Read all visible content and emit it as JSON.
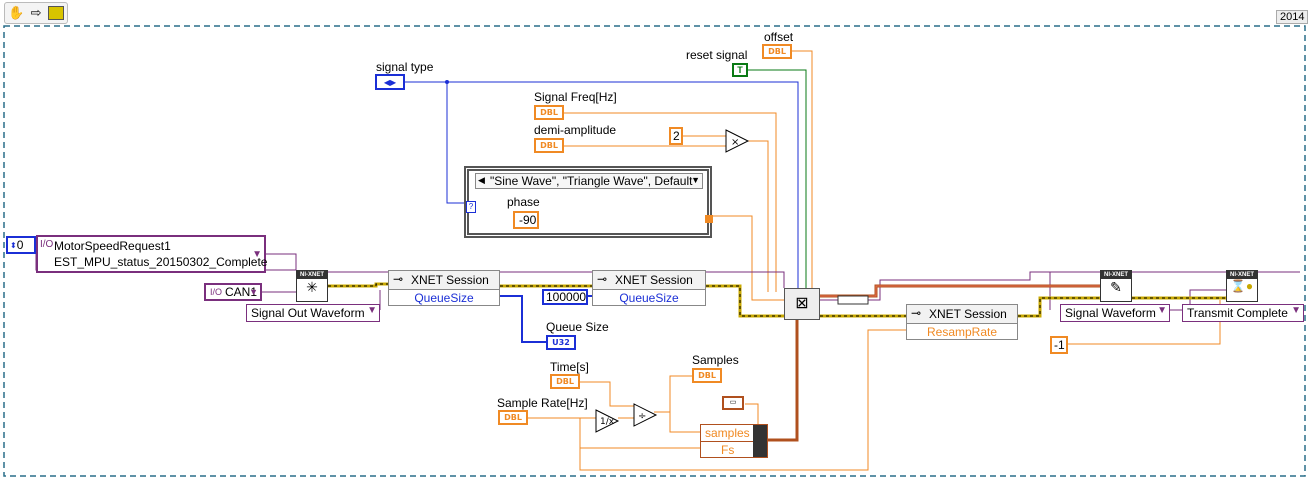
{
  "toolbar": {
    "version": "2014"
  },
  "labels": {
    "signal_type": "signal type",
    "signal_freq": "Signal Freq[Hz]",
    "demi_amplitude": "demi-amplitude",
    "phase": "phase",
    "reset_signal": "reset signal",
    "offset": "offset",
    "queue_size": "Queue Size",
    "time": "Time[s]",
    "samples": "Samples",
    "sample_rate": "Sample Rate[Hz]"
  },
  "terminals": {
    "dbl": "DBL",
    "u32": "U32",
    "bool_true": "T"
  },
  "constants": {
    "two": "2",
    "phase_value": "-90",
    "queue_const": "100000",
    "index_zero": "0",
    "minus_one": "-1"
  },
  "case_structure": {
    "selector": "\"Sine Wave\", \"Triangle Wave\", Default"
  },
  "database": {
    "line1": "MotorSpeedRequest1",
    "line2": "EST_MPU_status_20150302_Complete"
  },
  "interface": {
    "value": "CAN1"
  },
  "rings": {
    "signal_out_waveform": "Signal Out Waveform",
    "signal_waveform": "Signal Waveform",
    "transmit_complete": "Transmit Complete"
  },
  "property_nodes": [
    {
      "title": "XNET Session",
      "property": "QueueSize"
    },
    {
      "title": "XNET Session",
      "property": "QueueSize"
    },
    {
      "title": "XNET Session",
      "property": "ResampRate"
    }
  ],
  "vi_icons": {
    "nixnet": "NI-XNET"
  },
  "unbundle": {
    "samples": "samples",
    "fs": "Fs"
  },
  "colors": {
    "orange": "#f08a24",
    "blue": "#1b2fd6",
    "purple": "#7a2f7d",
    "green": "#0a7a14",
    "error": "#c8a800",
    "brown": "#b0501e"
  }
}
